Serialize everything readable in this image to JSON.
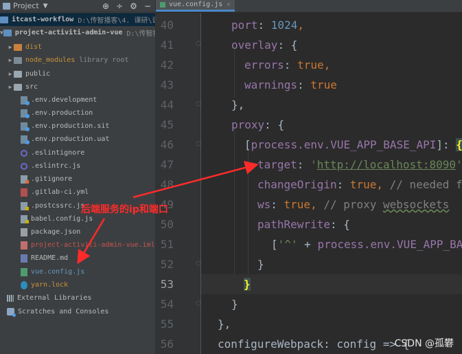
{
  "project_panel": {
    "title": "Project",
    "items": [
      {
        "label": "itcast-workflow",
        "path": "D:\\传智播客\\4. 课研\\课",
        "icon": "module-icon",
        "bold": true
      },
      {
        "label": "project-activiti-admin-vue",
        "path": "D:\\传智播客",
        "icon": "module-icon",
        "bold": true
      },
      {
        "label": "dist",
        "icon": "folder-excluded-icon"
      },
      {
        "label": "node_modules",
        "extra": "library root",
        "icon": "folder-library-icon"
      },
      {
        "label": "public",
        "icon": "folder-icon"
      },
      {
        "label": "src",
        "icon": "folder-icon"
      },
      {
        "label": ".env.development",
        "icon": "env-file-icon"
      },
      {
        "label": ".env.production",
        "icon": "env-file-icon"
      },
      {
        "label": ".env.production.sit",
        "icon": "env-file-icon"
      },
      {
        "label": ".env.production.uat",
        "icon": "env-file-icon"
      },
      {
        "label": ".eslintignore",
        "icon": "eslint-icon"
      },
      {
        "label": ".eslintrc.js",
        "icon": "eslint-icon"
      },
      {
        "label": ".gitignore",
        "icon": "git-file-icon"
      },
      {
        "label": ".gitlab-ci.yml",
        "icon": "yml-file-icon"
      },
      {
        "label": ".postcssrc.js",
        "icon": "js-file-icon"
      },
      {
        "label": "babel.config.js",
        "icon": "js-file-icon"
      },
      {
        "label": "package.json",
        "icon": "json-file-icon"
      },
      {
        "label": "project-activiti-admin-vue.iml",
        "icon": "iml-file-icon"
      },
      {
        "label": "README.md",
        "icon": "markdown-file-icon"
      },
      {
        "label": "vue.config.js",
        "icon": "vue-config-file-icon"
      },
      {
        "label": "yarn.lock",
        "icon": "yarn-file-icon"
      },
      {
        "label": "External Libraries",
        "icon": "external-libraries-icon"
      },
      {
        "label": "Scratches and Consoles",
        "icon": "scratches-icon"
      }
    ]
  },
  "editor": {
    "tab_label": "vue.config.js",
    "current_line": 53,
    "line_numbers": [
      "40",
      "41",
      "42",
      "43",
      "44",
      "45",
      "46",
      "47",
      "48",
      "49",
      "50",
      "51",
      "52",
      "53",
      "54",
      "55",
      "56"
    ],
    "code": {
      "l40_key": "port",
      "l40_val": "1024",
      "l41_key": "overlay",
      "l42_key": "errors",
      "l42_val": "true",
      "l43_key": "warnings",
      "l43_val": "true",
      "l44": "},",
      "l45_key": "proxy",
      "l46_expr": "process.env.VUE_APP_BASE_API",
      "l47_key": "target",
      "l47_url": "http://localhost:8090",
      "l48_key": "changeOrigin",
      "l48_val": "true",
      "l48_comment": "// needed fo",
      "l49_key": "ws",
      "l49_val": "true",
      "l49_comment_a": "// proxy ",
      "l49_comment_b": "websockets",
      "l50_key": "pathRewrite",
      "l51_str": "'^'",
      "l51_expr": "process.env.VUE_APP_BAS",
      "l52": "}",
      "l53": "}",
      "l54": "}",
      "l55": "},",
      "l56_key": "configureWebpack",
      "l56_expr": "config => {"
    }
  },
  "annotation": {
    "text": "后端服务的ip和端口",
    "color": "#ff2b2b"
  },
  "watermark": "CSDN @孤礬"
}
